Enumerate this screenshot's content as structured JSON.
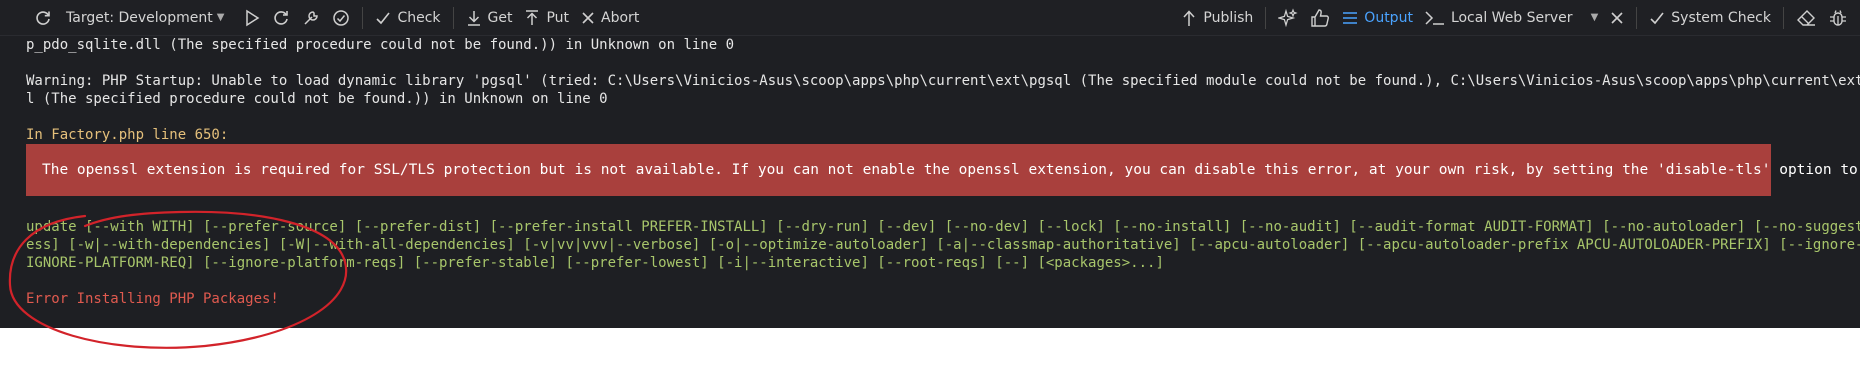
{
  "toolbar": {
    "target_label": "Target: Development",
    "check_label": "Check",
    "get_label": "Get",
    "put_label": "Put",
    "abort_label": "Abort",
    "publish_label": "Publish",
    "output_label": "Output",
    "local_web_server_label": "Local Web Server",
    "system_check_label": "System Check",
    "icons": [
      "refresh-icon",
      "run-icon",
      "reload-icon",
      "tools-icon",
      "check-circle-icon",
      "check-icon",
      "download-icon",
      "upload-icon",
      "close-icon",
      "upload-icon",
      "sparkle-icon",
      "thumbs-up-icon",
      "list-icon",
      "terminal-icon",
      "close-icon",
      "check-icon",
      "eraser-icon",
      "bug-icon"
    ],
    "accent_color": "#4aa3ff"
  },
  "console": {
    "lines": {
      "l1": "p_pdo_sqlite.dll (The specified procedure could not be found.)) in Unknown on line 0",
      "l2": "Warning: PHP Startup: Unable to load dynamic library 'pgsql' (tried: C:\\Users\\Vinicios-Asus\\scoop\\apps\\php\\current\\ext\\pgsql (The specified module could not be found.), C:\\Users\\Vinicios-Asus\\scoop\\apps\\php\\current\\ext\\php_pgsql.dl",
      "l3": "l (The specified procedure could not be found.)) in Unknown on line 0",
      "l4": "In Factory.php line 650:",
      "banner": "The openssl extension is required for SSL/TLS protection but is not available. If you can not enable the openssl extension, you can disable this error, at your own risk, by setting the 'disable-tls' option to true.",
      "u1": "update [--with WITH] [--prefer-source] [--prefer-dist] [--prefer-install PREFER-INSTALL] [--dry-run] [--dev] [--no-dev] [--lock] [--no-install] [--no-audit] [--audit-format AUDIT-FORMAT] [--no-autoloader] [--no-suggest] [--no-progr",
      "u2": "ess] [-w|--with-dependencies] [-W|--with-all-dependencies] [-v|vv|vvv|--verbose] [-o|--optimize-autoloader] [-a|--classmap-authoritative] [--apcu-autoloader] [--apcu-autoloader-prefix APCU-AUTOLOADER-PREFIX] [--ignore-platform-req",
      "u3": "IGNORE-PLATFORM-REQ] [--ignore-platform-reqs] [--prefer-stable] [--prefer-lowest] [-i|--interactive] [--root-reqs] [--] [<packages>...]",
      "error": "Error Installing PHP Packages!"
    },
    "colors": {
      "background": "#1e1f23",
      "banner": "#a9403d",
      "heading": "#e5c07b",
      "usage": "#a8c66b",
      "error": "#e05a4f",
      "annotation": "#d2232a"
    }
  }
}
